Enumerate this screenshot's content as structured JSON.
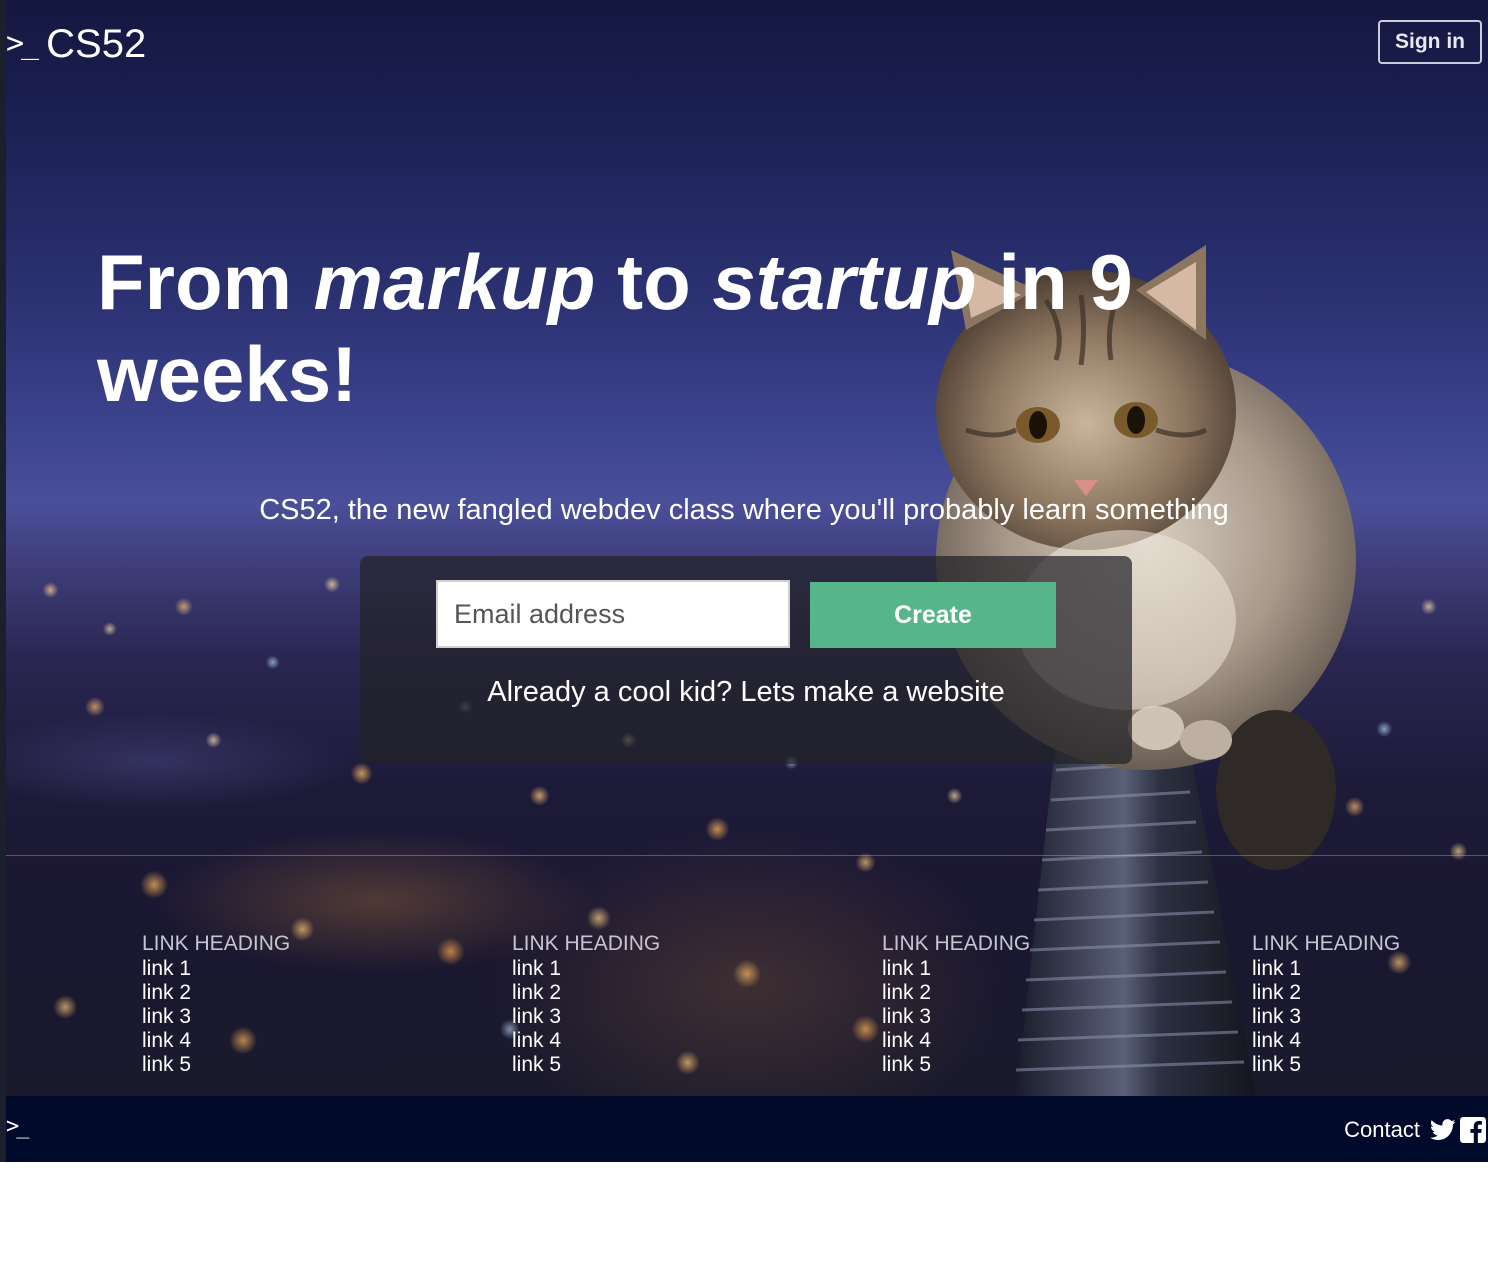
{
  "nav": {
    "brand_icon": ">_",
    "brand_name": "CS52",
    "signin_label": "Sign in"
  },
  "hero": {
    "headline_part1": "From ",
    "headline_em1": "markup",
    "headline_part2": " to ",
    "headline_em2": "startup",
    "headline_part3": " in 9 weeks!",
    "tagline": "CS52, the new fangled webdev class where you'll probably learn something"
  },
  "signup": {
    "email_placeholder": "Email address",
    "create_label": "Create",
    "existing_link": "Already a cool kid? Lets make a website"
  },
  "link_columns": [
    {
      "heading": "LINK HEADING",
      "links": [
        "link 1",
        "link 2",
        "link 3",
        "link 4",
        "link 5"
      ]
    },
    {
      "heading": "LINK HEADING",
      "links": [
        "link 1",
        "link 2",
        "link 3",
        "link 4",
        "link 5"
      ]
    },
    {
      "heading": "LINK HEADING",
      "links": [
        "link 1",
        "link 2",
        "link 3",
        "link 4",
        "link 5"
      ]
    },
    {
      "heading": "LINK HEADING",
      "links": [
        "link 1",
        "link 2",
        "link 3",
        "link 4",
        "link 5"
      ]
    }
  ],
  "footer": {
    "logo": ">_",
    "contact_label": "Contact",
    "social_icons": [
      "twitter-icon",
      "facebook-icon"
    ]
  },
  "colors": {
    "accent_green": "#56b68a",
    "footer_bg": "#010a2a",
    "hero_sky": "#2d3274"
  }
}
